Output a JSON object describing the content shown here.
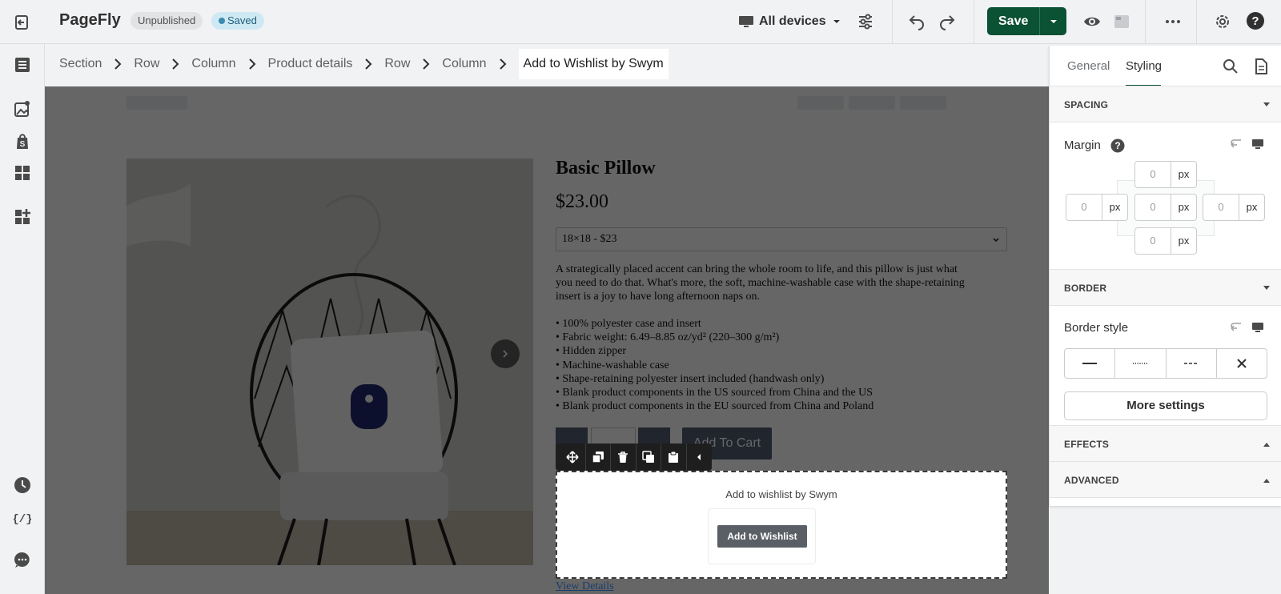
{
  "topbar": {
    "brand": "PageFly",
    "status_unpublished": "Unpublished",
    "status_saved": "Saved",
    "devices_label": "All devices",
    "save_label": "Save",
    "icons": [
      "exit-icon",
      "desktop-icon",
      "sliders-icon",
      "undo-icon",
      "redo-icon",
      "preview-eye-icon",
      "template-icon",
      "more-icon",
      "settings-icon",
      "help-icon"
    ]
  },
  "sidebar": {
    "items": [
      {
        "name": "layers",
        "icon": "layers-icon"
      },
      {
        "name": "media",
        "icon": "media-icon"
      },
      {
        "name": "shopify",
        "icon": "shopify-icon"
      },
      {
        "name": "elements",
        "icon": "grid-icon"
      },
      {
        "name": "add-apps",
        "icon": "add-apps-icon"
      },
      {
        "name": "history",
        "icon": "clock-icon"
      },
      {
        "name": "code",
        "icon": "code-icon"
      },
      {
        "name": "chat",
        "icon": "chat-icon"
      }
    ]
  },
  "breadcrumb": {
    "items": [
      "Section",
      "Row",
      "Column",
      "Product details",
      "Row",
      "Column",
      "Add to Wishlist by Swym"
    ]
  },
  "product": {
    "title": "Basic Pillow",
    "price": "$23.00",
    "variant": "18×18 - $23",
    "description": "A strategically placed accent can bring the whole room to life, and this pillow is just what you need to do that. What's more, the soft, machine-washable case with the shape-retaining insert is a joy to have long afternoon naps on.",
    "bullets": [
      "• 100% polyester case and insert",
      "• Fabric weight: 6.49–8.85 oz/yd² (220–300 g/m²)",
      "• Hidden zipper",
      "• Machine-washable case",
      "• Shape-retaining polyester insert included (handwash only)",
      "• Blank product components in the US sourced from China and the US",
      "• Blank product components in the EU sourced from China and Poland"
    ],
    "add_to_cart": "Add To Cart",
    "view_details": "View Details"
  },
  "wishlist": {
    "label": "Add to wishlist by Swym",
    "button": "Add to Wishlist"
  },
  "element_toolbar": {
    "tools": [
      "move-icon",
      "duplicate-icon",
      "delete-icon",
      "copy-style-icon",
      "paste-icon",
      "collapse-icon"
    ]
  },
  "right_panel": {
    "tabs": [
      "General",
      "Styling"
    ],
    "active_tab": "Styling",
    "spacing_title": "SPACING",
    "margin_label": "Margin",
    "margin": {
      "top": "0",
      "right": "0",
      "bottom": "0",
      "left": "0",
      "inner": "0",
      "unit": "px"
    },
    "border_title": "BORDER",
    "border_style_label": "Border style",
    "border_options": [
      "solid",
      "dotted",
      "dashed",
      "none"
    ],
    "more_settings": "More settings",
    "effects_title": "EFFECTS",
    "advanced_title": "ADVANCED"
  },
  "colors": {
    "save_green": "#0b5134",
    "saved_badge": "#cfe9f4",
    "cart_button": "#505d73"
  }
}
